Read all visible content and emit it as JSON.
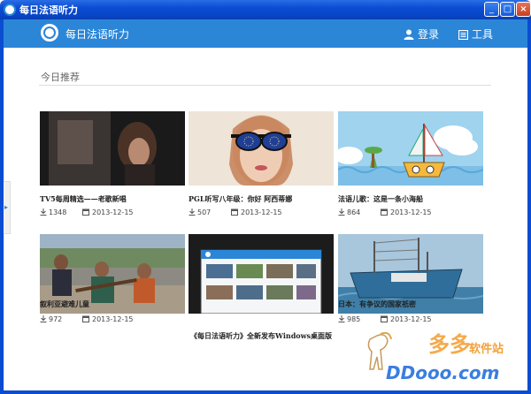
{
  "window": {
    "title": "每日法语听力",
    "buttons": {
      "minimize": "_",
      "maximize": "□",
      "close": "×"
    }
  },
  "header": {
    "app_title": "每日法语听力",
    "login_label": "登录",
    "tools_label": "工具",
    "brand_color": "#2b86d8"
  },
  "section": {
    "title": "今日推荐"
  },
  "cards": [
    {
      "title": "TV5每周精选——老歌新唱",
      "downloads": "1348",
      "date": "2013-12-15",
      "thumb": "dark-video-still"
    },
    {
      "title": "PGL听写八年级：你好 阿西蒂娜",
      "downloads": "507",
      "date": "2013-12-15",
      "thumb": "woman-flag-sunglasses"
    },
    {
      "title": "法语儿歌：这是一条小海船",
      "downloads": "864",
      "date": "2013-12-15",
      "thumb": "cartoon-boat"
    },
    {
      "title": "叙利亚避难儿童",
      "downloads": "972",
      "date": "2013-12-15",
      "thumb": "children-outdoors"
    },
    {
      "title": "《每日法语听力》全新发布Windows桌面版",
      "downloads": "",
      "date": "",
      "thumb": "app-screenshot"
    },
    {
      "title": "日本：有争议的国家祇密",
      "downloads": "985",
      "date": "2013-12-15",
      "thumb": "fishing-boat"
    }
  ],
  "watermark": {
    "brand": "多多软件站",
    "brand_large": "多多",
    "brand_small": "软件站",
    "url": "DDooo.com"
  },
  "side_tab": {
    "arrow": "▸"
  }
}
